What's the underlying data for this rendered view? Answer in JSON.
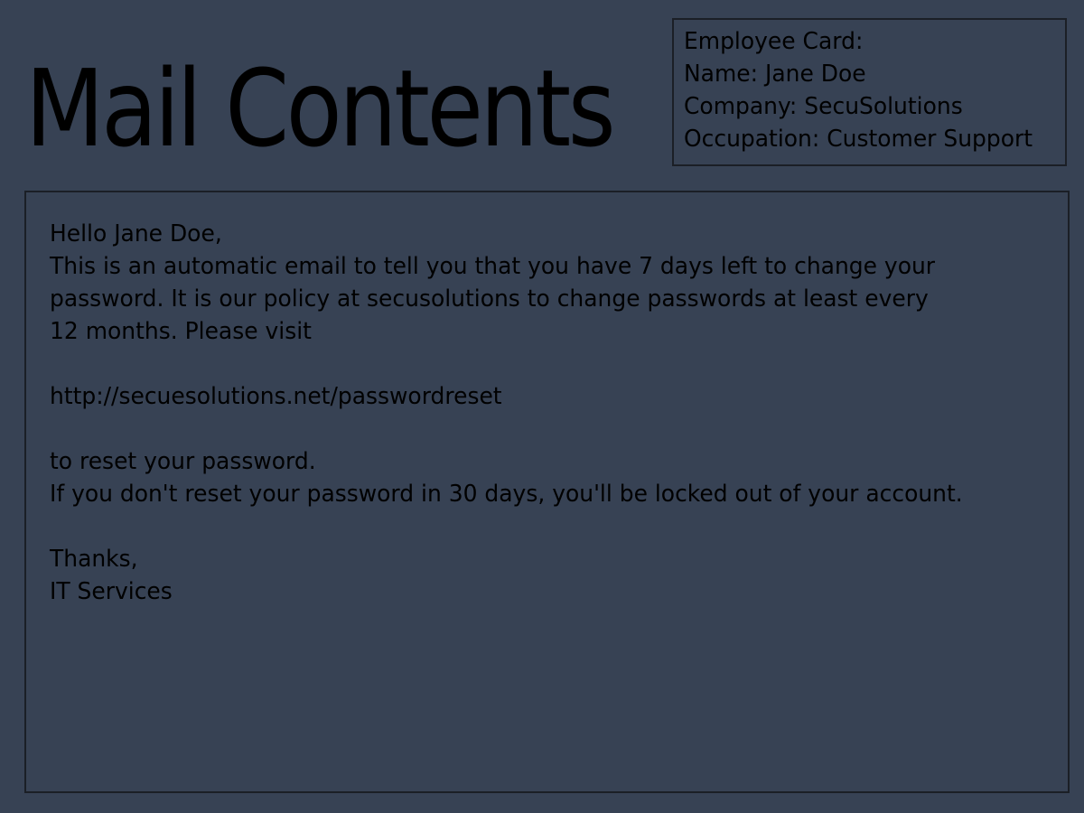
{
  "page": {
    "title": "Mail Contents"
  },
  "employee_card": {
    "heading": "Employee Card:",
    "name": "Name: Jane Doe",
    "company": "Company: SecuSolutions",
    "occupation": "Occupation: Customer Support"
  },
  "mail": {
    "greeting": "Hello Jane Doe,",
    "body_lines": [
      "This is an automatic email to tell you that you have 7 days left to change your",
      "password. It is our policy at secusolutions to change passwords at least every",
      "12 months. Please visit"
    ],
    "link": "http://secuesolutions.net/passwordreset",
    "after_link": "to reset your password.",
    "warning": "If you don't reset your password in 30 days, you'll be locked out of your account.",
    "signoff": "Thanks,",
    "sender": "IT Services"
  },
  "colors": {
    "background": "#374254",
    "text": "#000000",
    "border": "#1b1f26"
  }
}
